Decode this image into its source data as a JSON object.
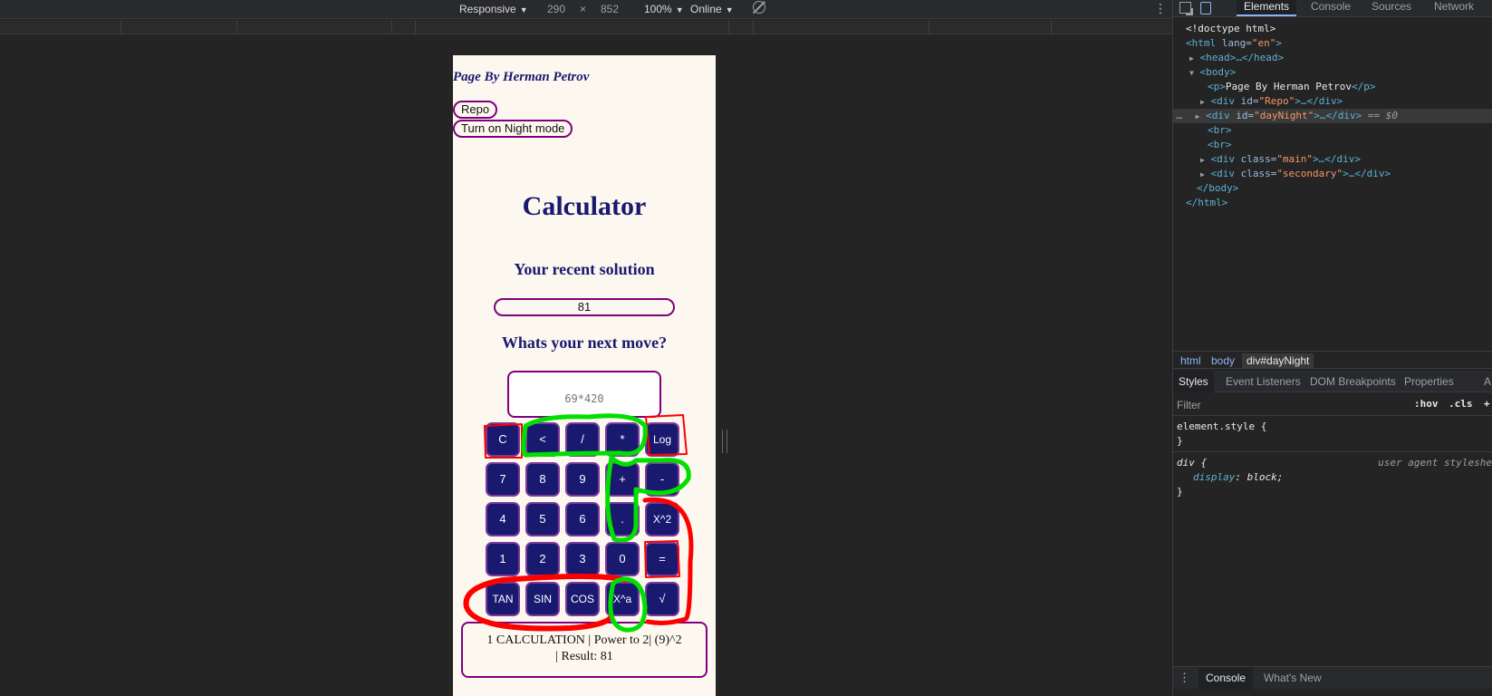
{
  "toolbar": {
    "device": "Responsive",
    "width": "290",
    "times": "×",
    "height": "852",
    "zoom": "100%",
    "network": "Online"
  },
  "page": {
    "author": "Page By Herman Petrov",
    "repo_button": "Repo",
    "night_button": "Turn on Night mode",
    "title": "Calculator",
    "recent_heading": "Your recent solution",
    "recent_value": "81",
    "next_heading": "Whats your next move?",
    "input_placeholder": "69*420",
    "keys": [
      [
        "C",
        "<",
        "/",
        "*",
        "Log"
      ],
      [
        "7",
        "8",
        "9",
        "+",
        "-"
      ],
      [
        "4",
        "5",
        "6",
        ".",
        "X^2"
      ],
      [
        "1",
        "2",
        "3",
        "0",
        "="
      ],
      [
        "TAN",
        "SIN",
        "COS",
        "X^a",
        "√"
      ]
    ],
    "history_line1": "1 CALCULATION | Power to 2| (9)^2",
    "history_line2": "| Result: 81",
    "annotation_colors": {
      "red": "#ff0000",
      "green": "#00e000"
    }
  },
  "devtools": {
    "tabs": [
      "Elements",
      "Console",
      "Sources",
      "Network"
    ],
    "dom": {
      "doctype": "<!doctype html>",
      "html_open_tag": "<html",
      "html_attr": " lang=",
      "html_attr_val": "\"en\"",
      "html_close_bracket": ">",
      "head": "<head>…</head>",
      "body_open": "<body>",
      "p_open": "<p>",
      "p_text": "Page By Herman Petrov",
      "p_close": "</p>",
      "div_open": "<div",
      "id_attr": " id=",
      "class_attr": " class=",
      "repo_id": "\"Repo\"",
      "daynight_id": "\"dayNight\"",
      "main_class": "\"main\"",
      "secondary_class": "\"secondary\"",
      "div_tail": ">…</div>",
      "eq_ref": " == $0",
      "br": "<br>",
      "body_close": "</body>",
      "html_close": "</html>",
      "ellipsis": "…"
    },
    "breadcrumbs": [
      "html",
      "body",
      "div#dayNight"
    ],
    "subtabs": [
      "Styles",
      "Event Listeners",
      "DOM Breakpoints",
      "Properties",
      "A"
    ],
    "filter_placeholder": "Filter",
    "hov": ":hov",
    "cls": ".cls",
    "plus": "+",
    "element_style": "element.style {",
    "brace_close": "}",
    "div_selector": "div {",
    "ua_label": "user agent styleshe",
    "prop_name": "display",
    "prop_value": "block;",
    "drawer_tabs": [
      "Console",
      "What's New"
    ]
  }
}
